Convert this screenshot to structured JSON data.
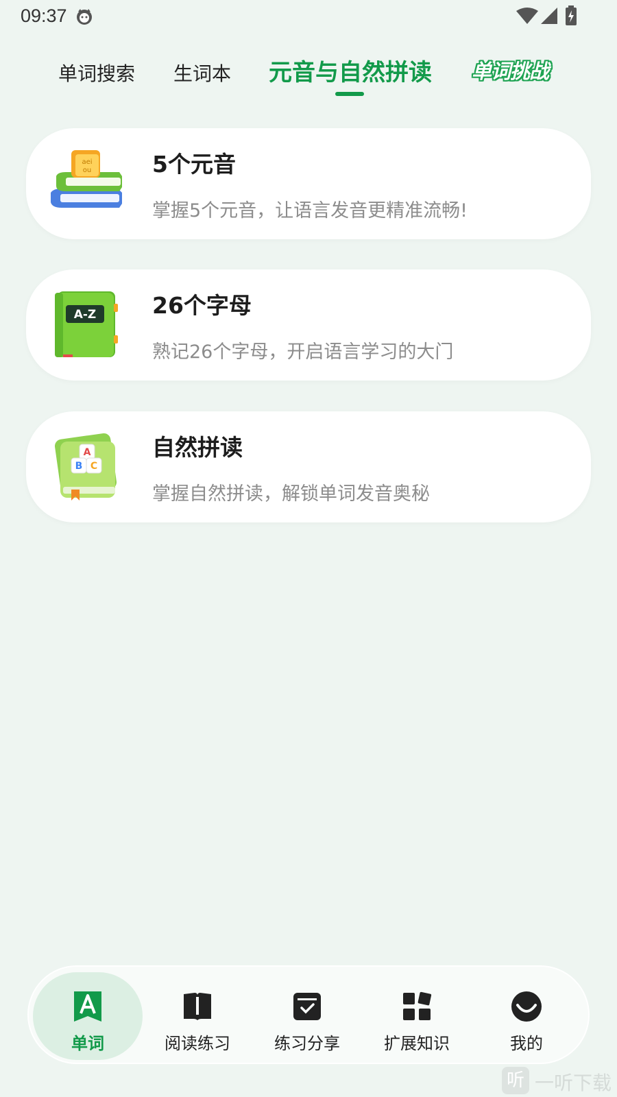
{
  "status_bar": {
    "time": "09:37",
    "icons": [
      "cat-face-icon",
      "wifi-icon",
      "cellular-signal-icon",
      "battery-charging-icon"
    ]
  },
  "top_tabs": {
    "items": [
      {
        "label": "单词搜索",
        "active": false
      },
      {
        "label": "生词本",
        "active": false
      },
      {
        "label": "元音与自然拼读",
        "active": true
      },
      {
        "label": "单词挑战",
        "active": false
      }
    ],
    "accent_color": "#129a4a"
  },
  "cards": [
    {
      "icon": "vowel-books-icon",
      "title": "5个元音",
      "description": "掌握5个元音，让语言发音更精准流畅!"
    },
    {
      "icon": "alphabet-book-icon",
      "title": "26个字母",
      "description": "熟记26个字母，开启语言学习的大门"
    },
    {
      "icon": "phonics-book-icon",
      "title": "自然拼读",
      "description": "掌握自然拼读，解锁单词发音奥秘"
    }
  ],
  "bottom_nav": {
    "items": [
      {
        "label": "单词",
        "icon": "letter-a-bookmark-icon",
        "active": true
      },
      {
        "label": "阅读练习",
        "icon": "open-book-icon",
        "active": false
      },
      {
        "label": "练习分享",
        "icon": "checked-box-icon",
        "active": false
      },
      {
        "label": "扩展知识",
        "icon": "grid-tiles-icon",
        "active": false
      },
      {
        "label": "我的",
        "icon": "smile-face-icon",
        "active": false
      }
    ]
  },
  "watermark": {
    "logo_char": "听",
    "text": "一听下载"
  }
}
